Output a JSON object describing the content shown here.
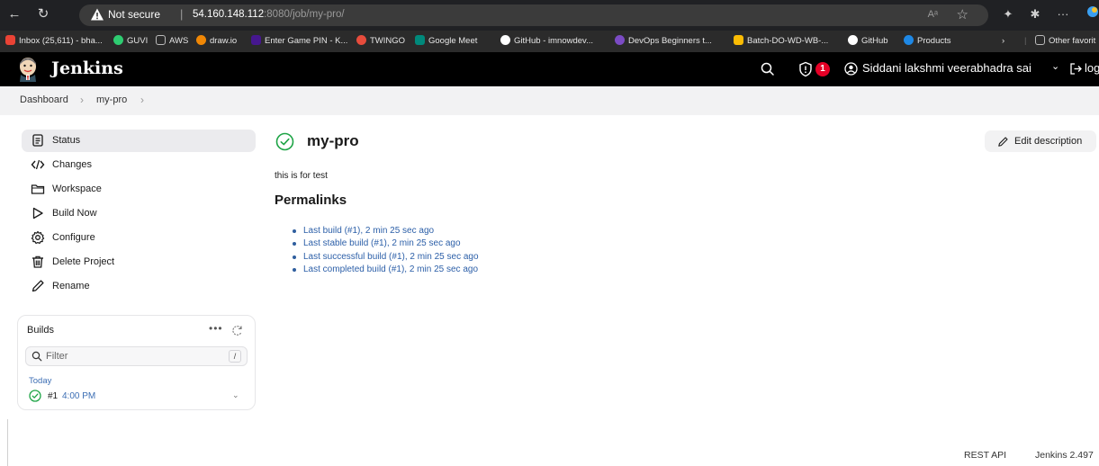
{
  "browser": {
    "security_label": "Not secure",
    "url_host": "54.160.148.112",
    "url_rest": ":8080/job/my-pro/",
    "read_aloud": "Aᵃ",
    "bookmarks": [
      {
        "label": "Inbox (25,611) - bha...",
        "color": "#ea4335"
      },
      {
        "label": "GUVI",
        "color": "#2ecc71"
      },
      {
        "label": "AWS",
        "color": "#777777"
      },
      {
        "label": "draw.io",
        "color": "#f08705"
      },
      {
        "label": "Enter Game PIN - K...",
        "color": "#46178f"
      },
      {
        "label": "TWINGO",
        "color": "#e74c3c"
      },
      {
        "label": "Google Meet",
        "color": "#00897b"
      },
      {
        "label": "GitHub - imnowdev...",
        "color": "#ffffff"
      },
      {
        "label": "DevOps Beginners t...",
        "color": "#7b4bc4"
      },
      {
        "label": "Batch-DO-WD-WB-...",
        "color": "#fbbc04"
      },
      {
        "label": "GitHub",
        "color": "#ffffff"
      },
      {
        "label": "Products",
        "color": "#1e88e5"
      },
      {
        "label": "Other favorit",
        "color": "#777777"
      }
    ]
  },
  "header": {
    "app_name": "Jenkins",
    "alert_count": "1",
    "user_name": "Siddani lakshmi veerabhadra sai",
    "logout_label": "log out"
  },
  "breadcrumb": [
    "Dashboard",
    "my-pro"
  ],
  "sidebar": {
    "items": [
      {
        "label": "Status",
        "icon": "status-icon"
      },
      {
        "label": "Changes",
        "icon": "code-icon"
      },
      {
        "label": "Workspace",
        "icon": "folder-icon"
      },
      {
        "label": "Build Now",
        "icon": "play-icon"
      },
      {
        "label": "Configure",
        "icon": "gear-icon"
      },
      {
        "label": "Delete Project",
        "icon": "trash-icon"
      },
      {
        "label": "Rename",
        "icon": "pencil-icon"
      }
    ]
  },
  "builds": {
    "title": "Builds",
    "filter_placeholder": "Filter",
    "filter_shortcut": "/",
    "group_label": "Today",
    "rows": [
      {
        "number": "#1",
        "time": "4:00 PM",
        "status": "success"
      }
    ]
  },
  "job": {
    "name": "my-pro",
    "description": "this is for test",
    "edit_description_label": "Edit description",
    "permalinks_heading": "Permalinks",
    "permalinks": [
      "Last build (#1), 2 min 25 sec ago",
      "Last stable build (#1), 2 min 25 sec ago",
      "Last successful build (#1), 2 min 25 sec ago",
      "Last completed build (#1), 2 min 25 sec ago"
    ]
  },
  "footer": {
    "rest_api": "REST API",
    "version": "Jenkins 2.497"
  },
  "colors": {
    "header_bg": "#000000",
    "success_green": "#1ea446",
    "link_blue": "#2c5fa8",
    "alert_red": "#e60026"
  }
}
